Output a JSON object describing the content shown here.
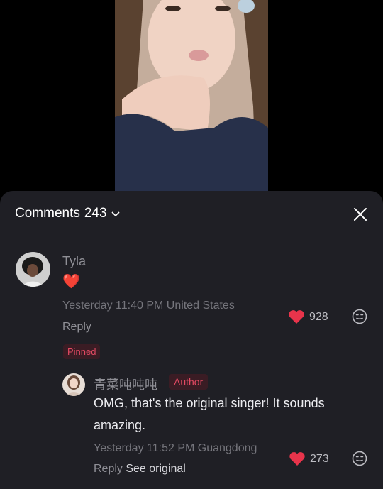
{
  "header": {
    "title": "Comments",
    "count": "243"
  },
  "comment": {
    "user": "Tyla",
    "text": "❤️",
    "meta": "Yesterday 11:40 PM United States",
    "reply_label": "Reply",
    "likes": "928",
    "pinned_label": "Pinned"
  },
  "reply": {
    "user": "青菜吨吨吨",
    "badge": "Author",
    "text": "OMG, that's the original singer! It sounds amazing.",
    "meta": "Yesterday 11:52 PM Guangdong",
    "reply_label": "Reply",
    "see_original_label": "See original",
    "likes": "273"
  },
  "colors": {
    "sheet_bg": "#1f1f25",
    "heart": "#e8344b",
    "badge_text": "#e34a63",
    "badge_bg": "#3a1c24"
  },
  "icons": [
    "chevron-down-icon",
    "close-icon",
    "heart-icon",
    "emoji-icon"
  ]
}
